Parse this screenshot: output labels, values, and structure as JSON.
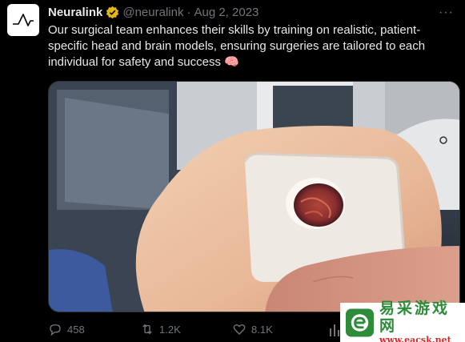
{
  "tweet": {
    "author_name": "Neuralink",
    "handle": "@neuralink",
    "separator": "·",
    "date": "Aug 2, 2023",
    "text": "Our surgical team enhances their skills by training on realistic, patient-specific head and brain models, ensuring surgeries are tailored to each individual for safety and success 🧠",
    "more_label": "···"
  },
  "media": {
    "description_icon": "video-still"
  },
  "actions": {
    "replies": "458",
    "reposts": "1.2K",
    "likes": "8.1K"
  },
  "watermark": {
    "site_name": "易采游戏网",
    "url": "www.eacsk.net"
  },
  "colors": {
    "background": "#000000",
    "text": "#e7e9ea",
    "muted": "#71767b",
    "verified_gold": "#e2b719"
  }
}
